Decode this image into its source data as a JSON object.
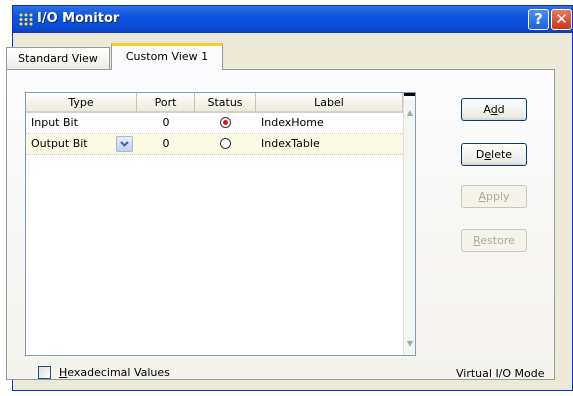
{
  "window": {
    "title": "I/O Monitor",
    "help_label": "?",
    "close_label": "✕"
  },
  "tabs": [
    {
      "label": "Standard View",
      "active": false
    },
    {
      "label": "Custom View 1",
      "active": true
    }
  ],
  "table": {
    "columns": [
      "Type",
      "Port",
      "Status",
      "Label"
    ],
    "rows": [
      {
        "type": "Input Bit",
        "port": "0",
        "status": "on",
        "label": "IndexHome"
      },
      {
        "type": "Output Bit",
        "port": "0",
        "status": "off",
        "label": "IndexTable"
      }
    ]
  },
  "buttons": {
    "add": {
      "pre": "A",
      "key": "d",
      "post": "d"
    },
    "delete": {
      "pre": "D",
      "key": "e",
      "post": "lete"
    },
    "apply": {
      "pre": "",
      "key": "A",
      "post": "pply"
    },
    "restore": {
      "pre": "",
      "key": "R",
      "post": "estore"
    }
  },
  "hex_checkbox": {
    "key": "H",
    "rest": "exadecimal Values",
    "checked": false
  },
  "status_text": "Virtual I/O Mode",
  "colors": {
    "title_bar": "#0a55e0",
    "status_on": "#e81010",
    "selected_row": "#fbfbe4"
  }
}
